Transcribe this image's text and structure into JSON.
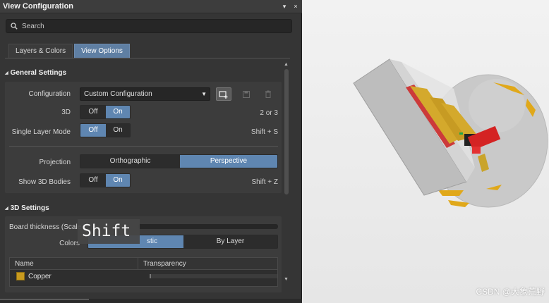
{
  "panel": {
    "title": "View Configuration",
    "pin_glyph": "▾",
    "close_glyph": "×"
  },
  "search": {
    "placeholder": "Search",
    "value": ""
  },
  "tabs": [
    {
      "label": "Layers & Colors",
      "active": false
    },
    {
      "label": "View Options",
      "active": true
    }
  ],
  "general_settings": {
    "header": "General Settings",
    "configuration": {
      "label": "Configuration",
      "value": "Custom Configuration"
    },
    "mode_3d": {
      "label": "3D",
      "options": [
        "Off",
        "On"
      ],
      "selected": "On",
      "shortcut": "2 or 3"
    },
    "single_layer_mode": {
      "label": "Single Layer Mode",
      "options": [
        "Off",
        "On"
      ],
      "selected": "Off",
      "shortcut": "Shift + S"
    },
    "projection": {
      "label": "Projection",
      "options": [
        "Orthographic",
        "Perspective"
      ],
      "selected": "Perspective"
    },
    "show_3d_bodies": {
      "label": "Show 3D Bodies",
      "options": [
        "Off",
        "On"
      ],
      "selected": "On",
      "shortcut": "Shift + Z"
    }
  },
  "settings_3d": {
    "header": "3D Settings",
    "board_thickness_label": "Board thickness (Scale",
    "colors": {
      "label": "Colors",
      "options": [
        "Realistic",
        "By Layer"
      ],
      "visible_partial": "stic",
      "selected": "Realistic"
    },
    "table": {
      "columns": [
        "Name",
        "Transparency"
      ],
      "rows": [
        {
          "name": "Copper",
          "color": "#c89a1e"
        }
      ]
    }
  },
  "tooltip": {
    "text": "Shift"
  },
  "watermark": {
    "text": "CSDN @大象荒野"
  },
  "icons": {
    "search": "search-icon",
    "add_config": "add-configuration-icon",
    "save_config": "save-icon",
    "delete_config": "trash-icon"
  }
}
